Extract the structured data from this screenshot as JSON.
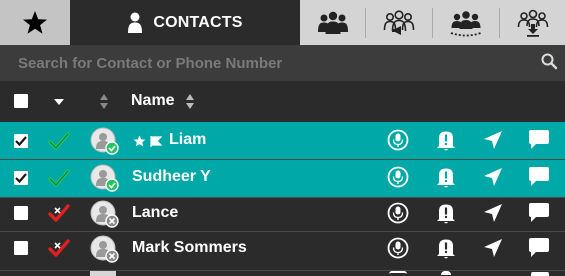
{
  "tabs": [
    {
      "icon": "star-icon"
    },
    {
      "label": "CONTACTS",
      "icon": "person-icon"
    },
    {
      "icon": "group-icon"
    },
    {
      "icon": "broadcast-group-icon"
    },
    {
      "icon": "group-dispatch-icon"
    },
    {
      "icon": "group-download-icon"
    }
  ],
  "search": {
    "placeholder": "Search for Contact or Phone Number"
  },
  "table": {
    "name_header": "Name",
    "rows": [
      {
        "name": "Liam",
        "checked": true,
        "selected": true,
        "status": "online",
        "favorite": true,
        "flag": true
      },
      {
        "name": "Sudheer Y",
        "checked": true,
        "selected": true,
        "status": "online",
        "favorite": false,
        "flag": false
      },
      {
        "name": "Lance",
        "checked": false,
        "selected": false,
        "status": "offline",
        "favorite": false,
        "flag": false
      },
      {
        "name": "Mark Sommers",
        "checked": false,
        "selected": false,
        "status": "offline",
        "favorite": false,
        "flag": false
      }
    ],
    "row_actions": [
      "microphone-icon",
      "alert-bell-icon",
      "location-arrow-icon",
      "message-icon"
    ]
  },
  "colors": {
    "accent": "#00a8a8",
    "online": "#22c55e",
    "offline": "#e02020",
    "background": "#2b2b2b"
  }
}
